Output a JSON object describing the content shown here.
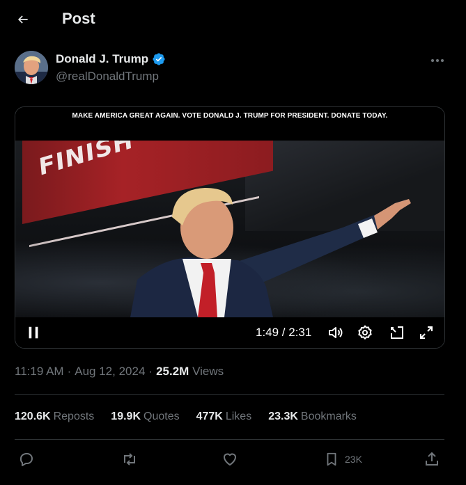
{
  "header": {
    "title": "Post"
  },
  "author": {
    "name": "Donald J. Trump",
    "handle": "@realDonaldTrump",
    "verified_color": "#1d9bf0"
  },
  "media": {
    "banner": "MAKE AMERICA GREAT AGAIN. VOTE DONALD J. TRUMP FOR PRESIDENT. DONATE TODAY.",
    "sign_text": "FINISH",
    "time": "1:49 / 2:31",
    "progress": 0.72,
    "controls": [
      "pause-icon",
      "volume-icon",
      "settings-icon",
      "pop-out-icon",
      "fullscreen-icon"
    ]
  },
  "meta": {
    "time": "11:19 AM",
    "separator1": "·",
    "date": "Aug 12, 2024",
    "separator2": "·",
    "views_count": "25.2M",
    "views_label": "Views"
  },
  "stats": {
    "reposts": {
      "count": "120.6K",
      "label": "Reposts"
    },
    "quotes": {
      "count": "19.9K",
      "label": "Quotes"
    },
    "likes": {
      "count": "477K",
      "label": "Likes"
    },
    "bookmarks": {
      "count": "23.3K",
      "label": "Bookmarks"
    }
  },
  "actions": {
    "bookmark_count": "23K"
  },
  "colors": {
    "background": "#000000",
    "text": "#e7e9ea",
    "muted": "#71767b",
    "border": "#2f3336",
    "accent": "#1d9bf0"
  }
}
